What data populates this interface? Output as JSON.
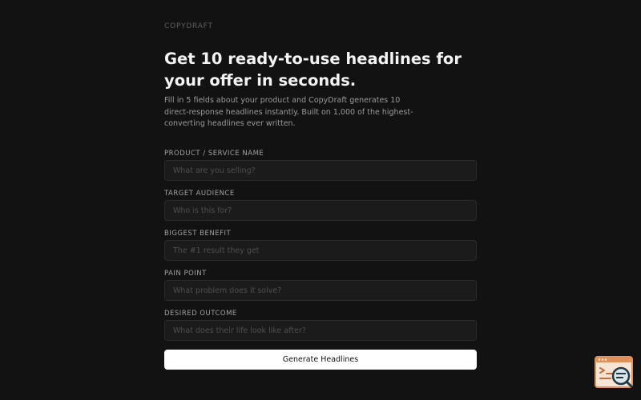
{
  "brand": "COPYDRAFT",
  "headline": "Get 10 ready-to-use headlines for your offer in seconds.",
  "subtext": "Fill in 5 fields about your product and CopyDraft generates 10 direct-response headlines instantly. Built on 1,000 of the highest-converting headlines ever written.",
  "form": {
    "fields": [
      {
        "label": "PRODUCT / SERVICE NAME",
        "placeholder": "What are you selling?",
        "value": ""
      },
      {
        "label": "TARGET AUDIENCE",
        "placeholder": "Who is this for?",
        "value": ""
      },
      {
        "label": "BIGGEST BENEFIT",
        "placeholder": "The #1 result they get",
        "value": ""
      },
      {
        "label": "PAIN POINT",
        "placeholder": "What problem does it solve?",
        "value": ""
      },
      {
        "label": "DESIRED OUTCOME",
        "placeholder": "What does their life look like after?",
        "value": ""
      }
    ],
    "submit_label": "Generate Headlines"
  },
  "widget": {
    "icon": "code-review-icon",
    "accent": "#e0915a"
  },
  "colors": {
    "background": "#121212",
    "button_bg": "#ffffff"
  }
}
